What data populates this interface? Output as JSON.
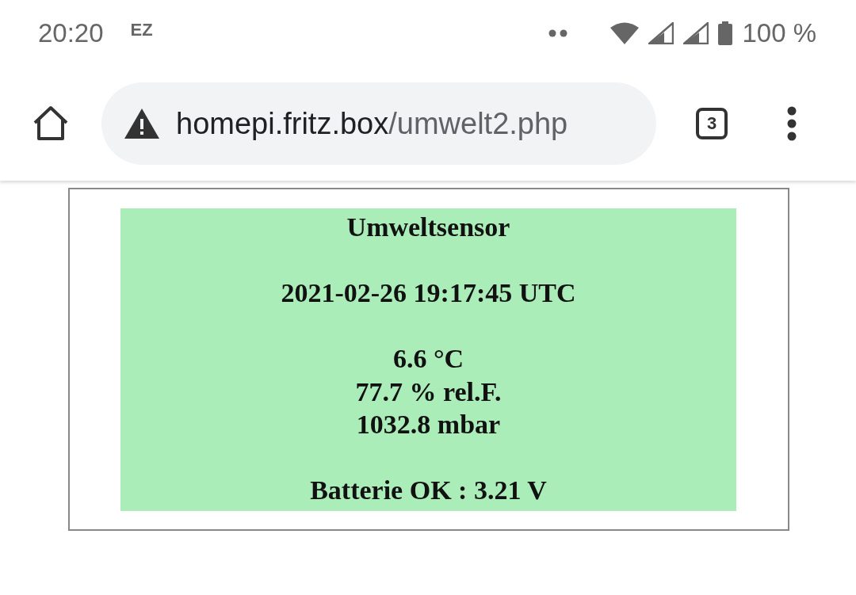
{
  "status_bar": {
    "time": "20:20",
    "app_badge": "EZ",
    "battery": "100 %"
  },
  "toolbar": {
    "url": {
      "host": "homepi.fritz.box",
      "path": "/umwelt2.php"
    },
    "tab_count": "3"
  },
  "sensor_panel": {
    "groups": [
      {
        "lines": [
          "Umweltsensor"
        ]
      },
      {
        "lines": [
          "2021-02-26 19:17:45 UTC"
        ]
      },
      {
        "lines": [
          "6.6 °C",
          "77.7 % rel.F.",
          "1032.8 mbar"
        ]
      },
      {
        "lines": [
          "Batterie OK : 3.21 V"
        ]
      }
    ]
  }
}
